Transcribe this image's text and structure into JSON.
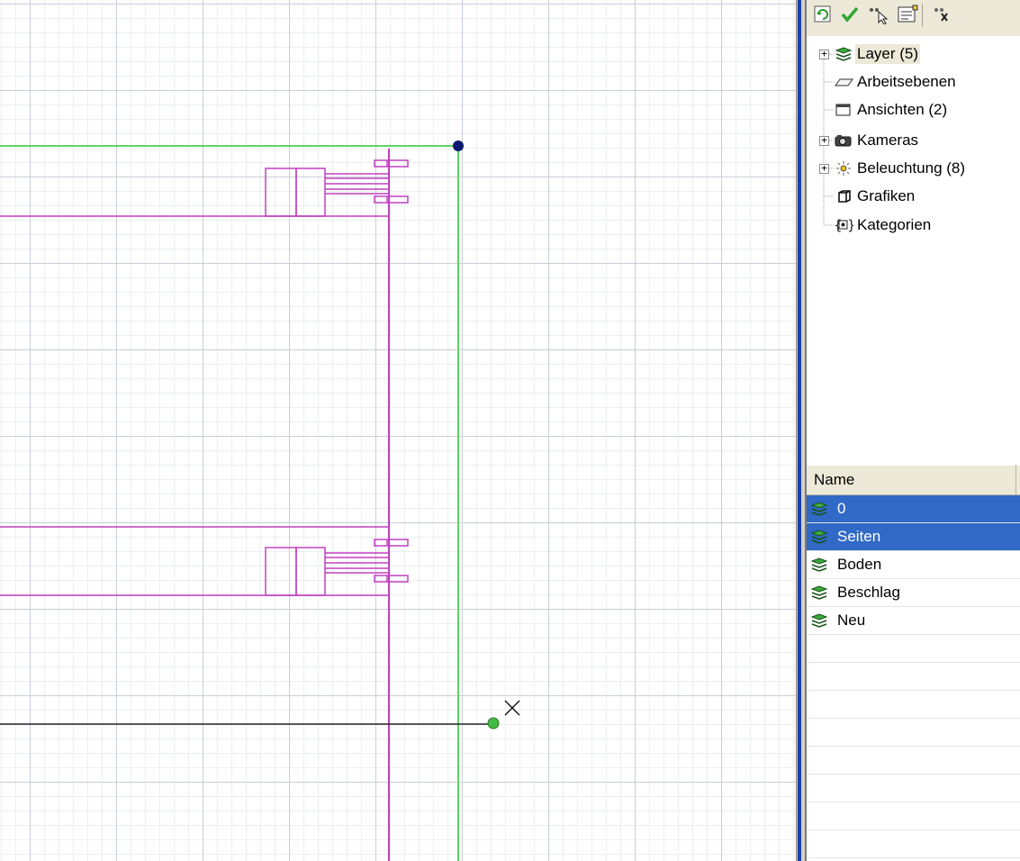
{
  "canvas": {
    "colors": {
      "grid_major": "#c9ced6",
      "grid_minor": "#eceef1",
      "magenta": "#c040c0",
      "green": "#5fd45f",
      "handle_blue": "#0a1a70",
      "handle_green": "#44bb44"
    }
  },
  "toolbar": {
    "buttons": [
      {
        "name": "refresh-icon"
      },
      {
        "name": "checkmark-icon"
      },
      {
        "name": "select-cursor-icon"
      },
      {
        "name": "properties-icon"
      },
      {
        "name": "snap-icon"
      }
    ]
  },
  "tree": {
    "items": [
      {
        "label": "Layer (5)",
        "icon": "layer-stack-icon",
        "expandable": true,
        "selected": true
      },
      {
        "label": "Arbeitsebenen",
        "icon": "workplane-icon",
        "expandable": false
      },
      {
        "label": "Ansichten (2)",
        "icon": "view-window-icon",
        "expandable": false
      },
      {
        "label": "Kameras",
        "icon": "camera-icon",
        "expandable": true
      },
      {
        "label": "Beleuchtung (8)",
        "icon": "light-icon",
        "expandable": true
      },
      {
        "label": "Grafiken",
        "icon": "graphic-cube-icon",
        "expandable": false
      },
      {
        "label": "Kategorien",
        "icon": "category-braces-icon",
        "expandable": false
      }
    ]
  },
  "layer_list": {
    "header": "Name",
    "rows": [
      {
        "label": "0",
        "selected": true
      },
      {
        "label": "Seiten",
        "selected": true
      },
      {
        "label": "Boden",
        "selected": false
      },
      {
        "label": "Beschlag",
        "selected": false
      },
      {
        "label": "Neu",
        "selected": false
      }
    ],
    "selection_color": "#3169c6"
  }
}
